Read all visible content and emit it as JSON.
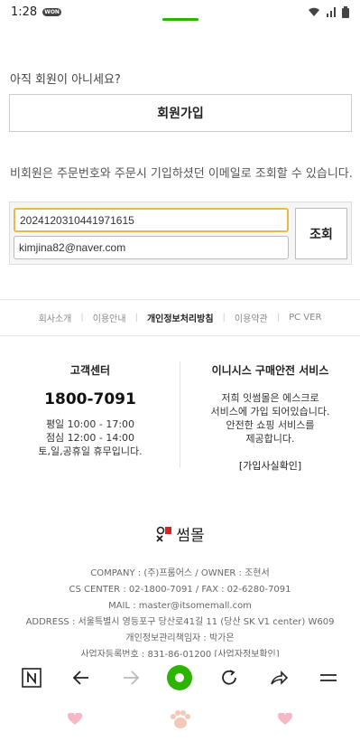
{
  "status": {
    "time": "1:28",
    "won_badge": "WON"
  },
  "signup": {
    "question": "아직 회원이 아니세요?",
    "button": "회원가입"
  },
  "guest_lookup": {
    "description": "비회원은 주문번호와 주문시 기입하셨던 이메일로 조회할 수 있습니다.",
    "order_number": "2024120310441971615",
    "email": "kimjina82@naver.com",
    "lookup_button": "조회"
  },
  "footer_nav": {
    "items": [
      "회사소개",
      "이용안내",
      "개인정보처리방침",
      "이용약관",
      "PC VER"
    ]
  },
  "customer_center": {
    "title": "고객센터",
    "phone": "1800-7091",
    "hours": [
      "평일 10:00 - 17:00",
      "점심 12:00 - 14:00",
      "토,일,공휴일 휴무입니다."
    ]
  },
  "inicis": {
    "title": "이니시스 구매안전 서비스",
    "text": [
      "저희 잇썸몰은 에스크로",
      "서비스에 가입 되어있습니다.",
      "안전한 쇼핑 서비스를",
      "제공합니다."
    ],
    "link": "[가입사실확인]"
  },
  "brand": {
    "name": "썸몰"
  },
  "company_info": {
    "lines": [
      "COMPANY : (주)프룸어스 / OWNER : 조현서",
      "CS CENTER : 02-1800-7091 / FAX : 02-6280-7091",
      "MAIL : master@itsomemall.com",
      "ADDRESS : 서울특별시 영등포구 당산로41길 11 (당산 SK V1 center) W609",
      "개인정보관리책임자 : 박가은",
      "사업자등록번호 : 831-86-01200 [사업자정보확인]"
    ]
  },
  "colors": {
    "accent_green": "#2db400",
    "input_focus": "#e6b94a",
    "logo_red": "#e02020"
  }
}
